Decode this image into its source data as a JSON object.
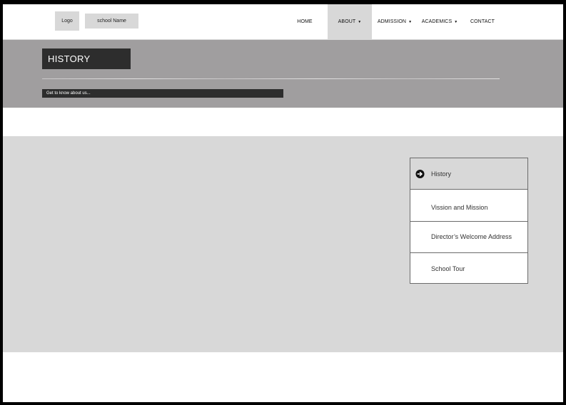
{
  "header": {
    "logo": "Logo",
    "school_name": "school Name",
    "nav": [
      {
        "label": "HOME",
        "dropdown": false,
        "active": false
      },
      {
        "label": "ABOUT",
        "dropdown": true,
        "active": true
      },
      {
        "label": "ADMISSION",
        "dropdown": true,
        "active": false
      },
      {
        "label": "ACADEMICS",
        "dropdown": true,
        "active": false
      },
      {
        "label": "CONTACT",
        "dropdown": false,
        "active": false
      }
    ]
  },
  "banner": {
    "title": "HISTORY",
    "subtitle": "Get to know about us..."
  },
  "side_menu": {
    "items": [
      {
        "label": "History",
        "icon": "arrow-circle-right-icon",
        "active": true
      },
      {
        "label": "Vission and Mission"
      },
      {
        "label": "Director’s Welcome Address"
      },
      {
        "label": "School Tour"
      }
    ]
  },
  "colors": {
    "banner_bg": "#a09e9f",
    "content_bg": "#d8d8d8",
    "dark_box": "#2d2d2d",
    "active_nav": "#d8d8d8"
  }
}
